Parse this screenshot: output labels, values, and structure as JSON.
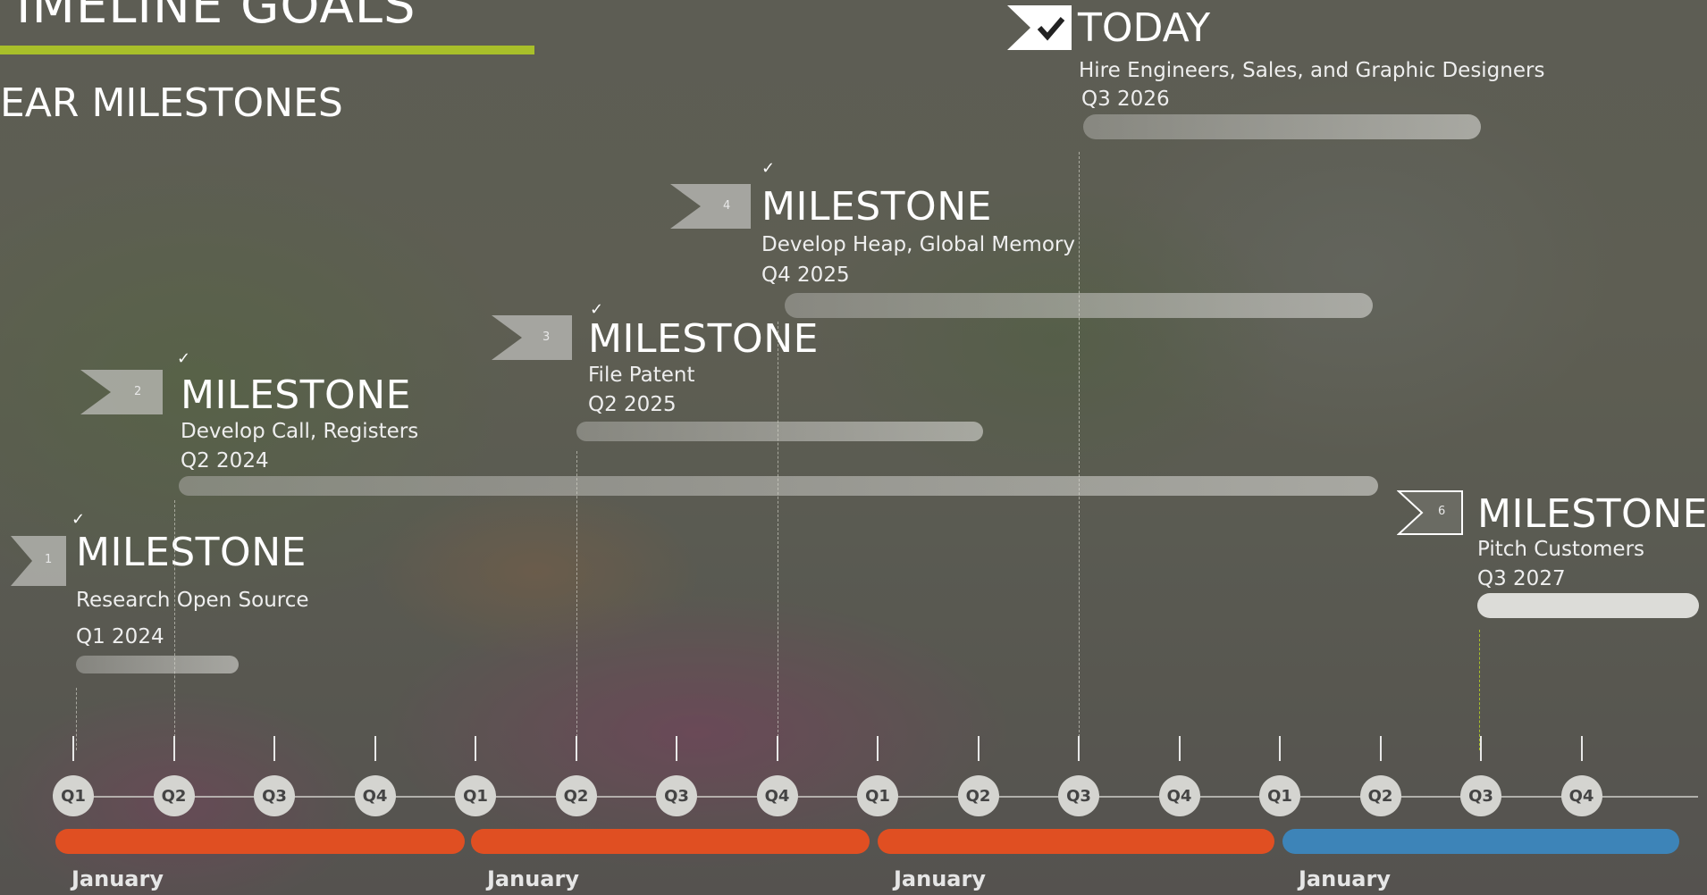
{
  "header": {
    "title": "IMELINE GOALS",
    "subtitle": "EAR MILESTONES"
  },
  "today": {
    "label": "TODAY",
    "description": "Hire Engineers, Sales, and Graphic Designers",
    "date": "Q3 2026"
  },
  "milestones": [
    {
      "number": "1",
      "title": "MILESTONE",
      "description": "Research Open Source",
      "date": "Q1 2024"
    },
    {
      "number": "2",
      "title": "MILESTONE",
      "description": "Develop Call, Registers",
      "date": "Q2 2024"
    },
    {
      "number": "3",
      "title": "MILESTONE",
      "description": "File Patent",
      "date": "Q2 2025"
    },
    {
      "number": "4",
      "title": "MILESTONE",
      "description": "Develop Heap, Global Memory",
      "date": "Q4 2025"
    },
    {
      "number": "6",
      "title": "MILESTONE",
      "description": "Pitch Customers",
      "date": "Q3 2027"
    }
  ],
  "quarters": [
    "Q1",
    "Q2",
    "Q3",
    "Q4",
    "Q1",
    "Q2",
    "Q3",
    "Q4",
    "Q1",
    "Q2",
    "Q3",
    "Q4",
    "Q1",
    "Q2",
    "Q3",
    "Q4"
  ],
  "years": [
    {
      "month": "January",
      "color": "#e04f22"
    },
    {
      "month": "January",
      "color": "#e04f22"
    },
    {
      "month": "January",
      "color": "#e04f22"
    },
    {
      "month": "January",
      "color": "#3d84b8"
    }
  ],
  "colors": {
    "accent": "#a8bf2a",
    "year_orange": "#e04f22",
    "year_blue": "#3d84b8"
  },
  "icons": [
    "check-icon",
    "flag-icon"
  ]
}
